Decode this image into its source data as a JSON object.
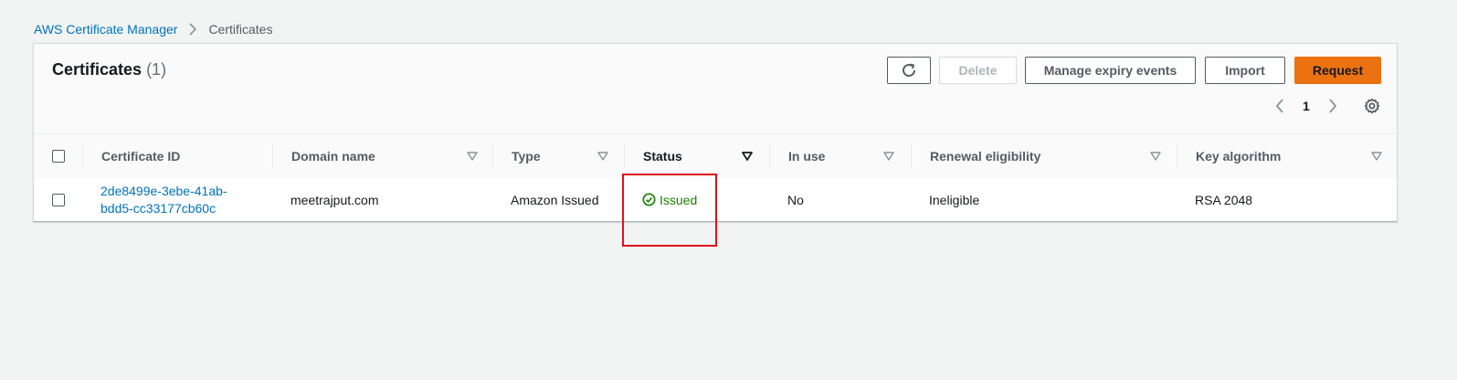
{
  "breadcrumb": {
    "parent": "AWS Certificate Manager",
    "current": "Certificates"
  },
  "panel": {
    "title": "Certificates",
    "count": "(1)"
  },
  "toolbar": {
    "refresh_icon": "refresh-icon",
    "delete_label": "Delete",
    "manage_label": "Manage expiry events",
    "import_label": "Import",
    "request_label": "Request"
  },
  "pagination": {
    "current_page": "1",
    "prev_icon": "chevron-left-icon",
    "next_icon": "chevron-right-icon",
    "settings_icon": "gear-icon"
  },
  "table": {
    "columns": [
      "Certificate ID",
      "Domain name",
      "Type",
      "Status",
      "In use",
      "Renewal eligibility",
      "Key algorithm"
    ],
    "rows": [
      {
        "certificate_id_line1": "2de8499e-3ebe-41ab-",
        "certificate_id_line2": "bdd5-cc33177cb60c",
        "domain_name": "meetrajput.com",
        "type": "Amazon Issued",
        "status": "Issued",
        "in_use": "No",
        "renewal_eligibility": "Ineligible",
        "key_algorithm": "RSA 2048"
      }
    ]
  },
  "colors": {
    "link": "#0073bb",
    "primary": "#ec7211",
    "success": "#1d8102",
    "highlight": "#e0101a"
  }
}
